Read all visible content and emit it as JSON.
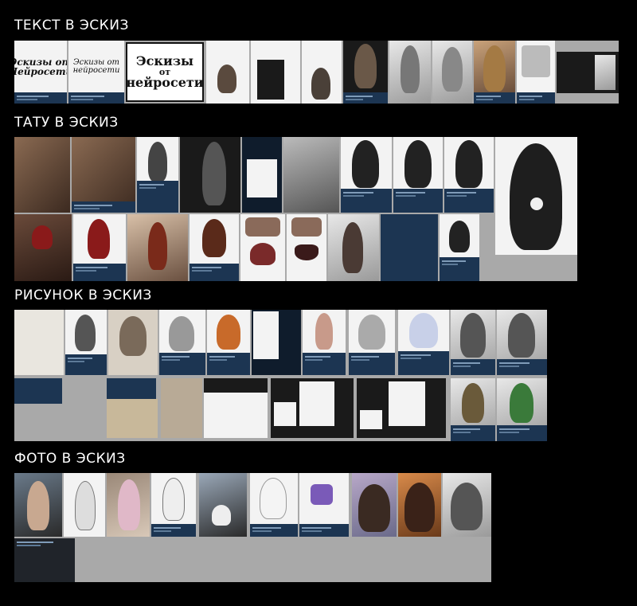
{
  "sections": {
    "text": {
      "title": "ТЕКСТ В ЭСКИЗ"
    },
    "tattoo": {
      "title": "ТАТУ В ЭСКИЗ"
    },
    "drawing": {
      "title": "РИСУНОК В ЭСКИЗ"
    },
    "photo": {
      "title": "ФОТО В ЭСКИЗ"
    }
  },
  "text_samples": {
    "sample1": "Эскизы от Нейросети",
    "sample2": "Эскизы от нейросети",
    "sample3_line1": "Эскизы",
    "sample3_line2": "от",
    "sample3_line3": "нейросети"
  },
  "colors": {
    "background": "#000000",
    "panel": "#a9a9a9",
    "caption": "#1c3552",
    "title": "#ffffff"
  }
}
